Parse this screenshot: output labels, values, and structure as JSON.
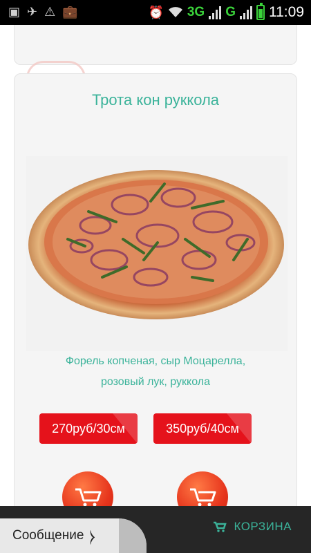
{
  "status_bar": {
    "network_1": "3G",
    "network_2": "G",
    "time": "11:09",
    "icons": [
      "image-icon",
      "airplane-icon",
      "warning-icon",
      "briefcase-icon",
      "alarm-icon",
      "wifi-icon",
      "battery-icon"
    ]
  },
  "product": {
    "title": "Трота кон руккола",
    "ingredients_part1": "Форель копченая, сыр Моцарелла,",
    "ingredients_part2": "розовый лук, руккола",
    "prices": [
      {
        "label": "270руб/30см"
      },
      {
        "label": "350руб/40см"
      }
    ]
  },
  "bottom_bar": {
    "message_tab_label": "Сообщение",
    "cart_label": "КОРЗИНА"
  },
  "colors": {
    "accent_teal": "#3bb39a",
    "price_red": "#e5121b",
    "cart_orange": "#e6341c",
    "bottom_bar": "#262626"
  }
}
